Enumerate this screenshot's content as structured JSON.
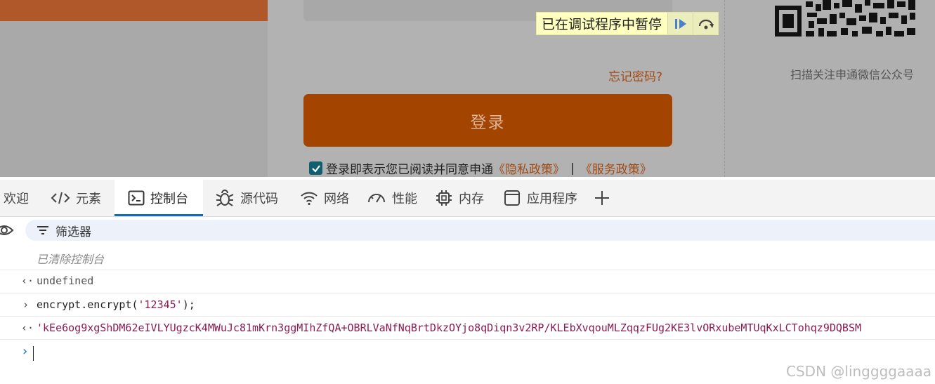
{
  "page": {
    "debugger": {
      "label": "已在调试程序中暂停"
    },
    "forgot_password": "忘记密码?",
    "login_button": "登录",
    "agreement": {
      "text": "登录即表示您已阅读并同意申通",
      "privacy_link": "《隐私政策》",
      "separator": "|",
      "service_link": "《服务政策》",
      "checked": true
    },
    "qr_caption": "扫描关注申通微信公众号",
    "colors": {
      "brand": "#a34400",
      "link": "#a04a16"
    }
  },
  "devtools": {
    "tabs": [
      {
        "label": "欢迎",
        "icon": ""
      },
      {
        "label": "元素",
        "icon": "elements-icon"
      },
      {
        "label": "控制台",
        "icon": "console-icon",
        "active": true
      },
      {
        "label": "源代码",
        "icon": "bug-icon"
      },
      {
        "label": "网络",
        "icon": "wifi-icon"
      },
      {
        "label": "性能",
        "icon": "gauge-icon"
      },
      {
        "label": "内存",
        "icon": "chip-icon"
      },
      {
        "label": "应用程序",
        "icon": "application-icon"
      }
    ],
    "add_tab_icon": "plus-icon",
    "filter": {
      "label": "筛选器"
    },
    "console": {
      "cleared": "已清除控制台",
      "result1": "undefined",
      "input_prefix": "encrypt.encrypt(",
      "input_arg": "'12345'",
      "input_suffix": ");",
      "result2": "'kEe6og9xgShDM62eIVLYUgzcK4MWuJc81mKrn3ggMIhZfQA+OBRLVaNfNqBrtDkzOYjo8qDiqn3v2RP/KLEbXvqouMLZqqzFUg2KE3lvORxubeMTUqKxLCTohqz9DQBSM"
    }
  },
  "watermark": "CSDN @linggggaaaa"
}
